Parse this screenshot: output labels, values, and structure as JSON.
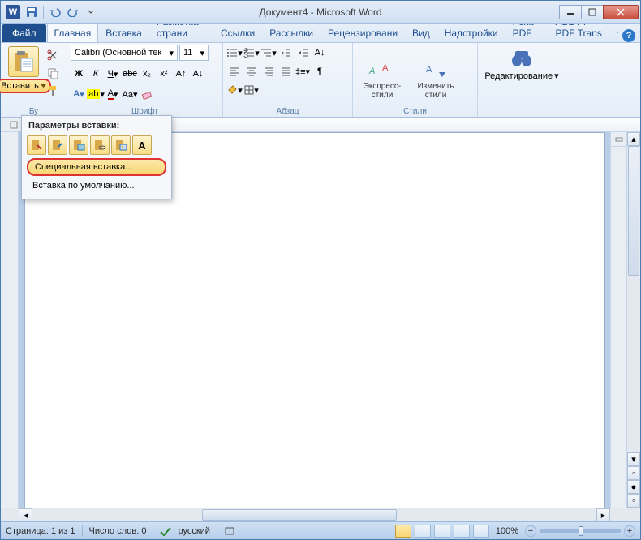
{
  "title": "Документ4 - Microsoft Word",
  "qat": {
    "save": "save-icon",
    "undo": "undo-icon",
    "redo": "redo-icon"
  },
  "tabs": {
    "file": "Файл",
    "items": [
      "Главная",
      "Вставка",
      "Разметка страни",
      "Ссылки",
      "Рассылки",
      "Рецензировани",
      "Вид",
      "Надстройки",
      "Foxit PDF",
      "ABBYY PDF Trans"
    ],
    "active_index": 0
  },
  "ribbon": {
    "clipboard": {
      "paste": "Вставить",
      "label": "Бу"
    },
    "font": {
      "name": "Calibri (Основной тек",
      "size": "11",
      "label": "Шрифт"
    },
    "paragraph": {
      "label": "Абзац"
    },
    "styles": {
      "quick": "Экспресс-стили",
      "change": "Изменить стили",
      "label": "Стили"
    },
    "editing": {
      "label": "Редактирование"
    }
  },
  "paste_menu": {
    "header": "Параметры вставки:",
    "special": "Специальная вставка...",
    "default": "Вставка по умолчанию..."
  },
  "status": {
    "page": "Страница: 1 из 1",
    "words": "Число слов: 0",
    "lang": "русский",
    "zoom": "100%"
  },
  "colors": {
    "accent": "#2b579a",
    "highlight_border": "#d33"
  }
}
